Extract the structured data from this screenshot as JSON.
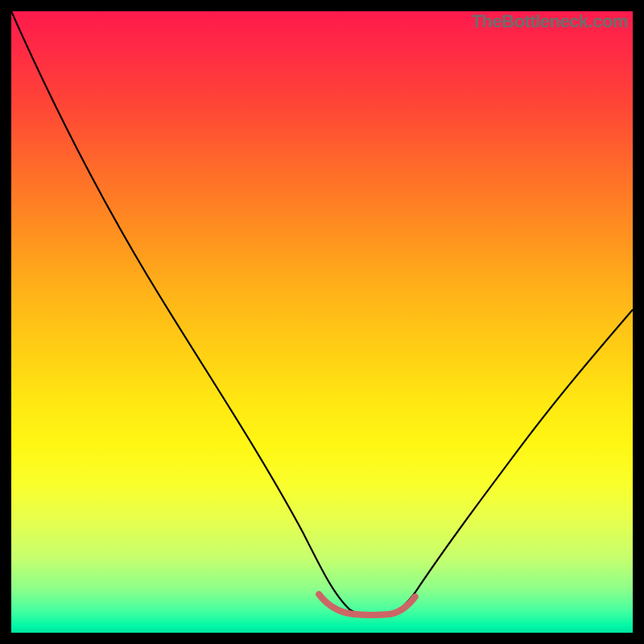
{
  "watermark": "TheBottleneck.com",
  "chart_data": {
    "type": "line",
    "title": "",
    "xlabel": "",
    "ylabel": "",
    "xlim": [
      0,
      100
    ],
    "ylim": [
      0,
      100
    ],
    "background_gradient": {
      "top": "#ff1a4c",
      "bottom": "#00e49e",
      "band_bottom_thin": "#00f7a6"
    },
    "series": [
      {
        "name": "curve",
        "color": "#000000",
        "width": 2.2,
        "x": [
          0,
          5,
          10,
          15,
          20,
          25,
          30,
          35,
          40,
          45,
          50,
          52,
          54,
          56,
          58,
          60,
          62,
          65,
          70,
          75,
          80,
          85,
          90,
          95,
          100
        ],
        "y": [
          100,
          90,
          80,
          71,
          62,
          54,
          46,
          39,
          32,
          25,
          17,
          11,
          6,
          4,
          3,
          3,
          3,
          5,
          10,
          18,
          26,
          33,
          40,
          46,
          52
        ]
      },
      {
        "name": "highlight-trough",
        "color": "#cc6666",
        "width": 8,
        "x": [
          50,
          52,
          54,
          56,
          58,
          60,
          62,
          64
        ],
        "y": [
          6,
          4,
          3,
          3,
          3,
          3,
          4,
          6
        ]
      }
    ]
  }
}
